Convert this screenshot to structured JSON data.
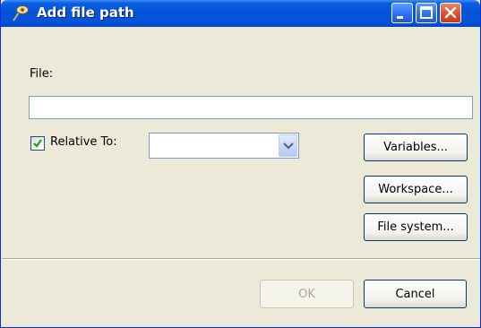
{
  "window": {
    "title": "Add file path",
    "icon": "app-icon",
    "controls": [
      "minimize-icon",
      "maximize-icon",
      "close-icon"
    ]
  },
  "form": {
    "file_label": "File:",
    "file_value": "",
    "relative_checkbox_checked": true,
    "relative_label": "Relative To:",
    "relative_to_value": ""
  },
  "buttons": {
    "variables": "Variables...",
    "workspace": "Workspace...",
    "file_system": "File system...",
    "ok": "OK",
    "cancel": "Cancel"
  },
  "colors": {
    "titlebar": "#0653d8",
    "dialog_bg": "#ece9d8",
    "close_button": "#d9502c",
    "checkmark": "#21a121"
  }
}
